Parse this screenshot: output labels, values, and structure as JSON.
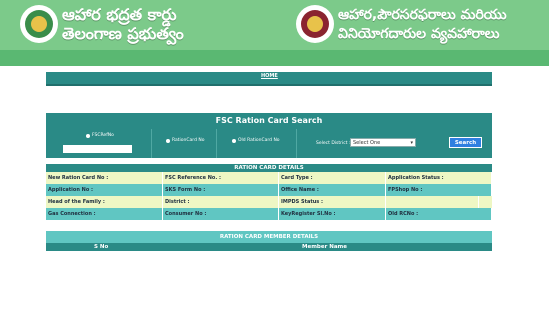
{
  "header": {
    "left_title_line1": "ఆహార భద్రత కార్డు",
    "left_title_line2": "తెలంగాణ ప్రభుత్వం",
    "right_title_line1": "ఆహార,పౌరసరఫరాలు మరియు",
    "right_title_line2": "వినియోగదారుల వ్యవహారాలు"
  },
  "nav": {
    "home_label": "HOME"
  },
  "search": {
    "title": "FSC Ration Card Search",
    "options": [
      "FSCRefNo",
      "RationCard No",
      "Old RationCard No"
    ],
    "district_label": "Select District :",
    "district_value": "Select One",
    "button_label": "Search"
  },
  "details": {
    "title": "RATION CARD DETAILS",
    "rows": [
      [
        "New Ration Card No :",
        "FSC Reference No. :",
        "Card Type :",
        "Application Status :"
      ],
      [
        "Application No :",
        "SKS Form No :",
        "Office Name :",
        "FPShop No :"
      ],
      [
        "Head of the Family :",
        "District :",
        "IMPDS Status :",
        ""
      ],
      [
        "Gas Connection :",
        "Consumer No :",
        "KeyRegister Sl.No :",
        "Old RCNo :"
      ]
    ]
  },
  "members": {
    "title": "RATION CARD MEMBER DETAILS",
    "col_sno": "S No",
    "col_name": "Member Name"
  },
  "colors": {
    "header_green": "#7cca8a",
    "band_green": "#5ab872",
    "teal": "#2a8a86",
    "light_teal": "#60c6c2",
    "cream": "#eef7c4",
    "search_button": "#2f7fe0"
  }
}
